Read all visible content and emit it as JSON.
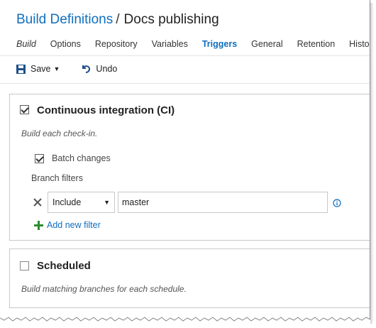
{
  "breadcrumb": {
    "parent": "Build Definitions",
    "separator": "/",
    "current": "Docs publishing"
  },
  "tabs": [
    {
      "label": "Build",
      "style": "italic"
    },
    {
      "label": "Options"
    },
    {
      "label": "Repository"
    },
    {
      "label": "Variables"
    },
    {
      "label": "Triggers",
      "active": true
    },
    {
      "label": "General"
    },
    {
      "label": "Retention"
    },
    {
      "label": "History"
    }
  ],
  "toolbar": {
    "save_label": "Save",
    "undo_label": "Undo"
  },
  "ci": {
    "title": "Continuous integration (CI)",
    "checked": true,
    "description": "Build each check-in.",
    "batch_label": "Batch changes",
    "batch_checked": true,
    "branch_filters_label": "Branch filters",
    "filters": [
      {
        "type": "Include",
        "value": "master"
      }
    ],
    "add_filter_label": "Add new filter"
  },
  "scheduled": {
    "title": "Scheduled",
    "checked": false,
    "description": "Build matching branches for each schedule."
  },
  "colors": {
    "accent": "#106ebe",
    "add_green": "#2e8b2e"
  },
  "icons": {
    "save": "floppy-disk-icon",
    "undo": "undo-arrow-icon",
    "remove": "close-x-icon",
    "info": "info-circle-icon",
    "add": "plus-icon"
  }
}
